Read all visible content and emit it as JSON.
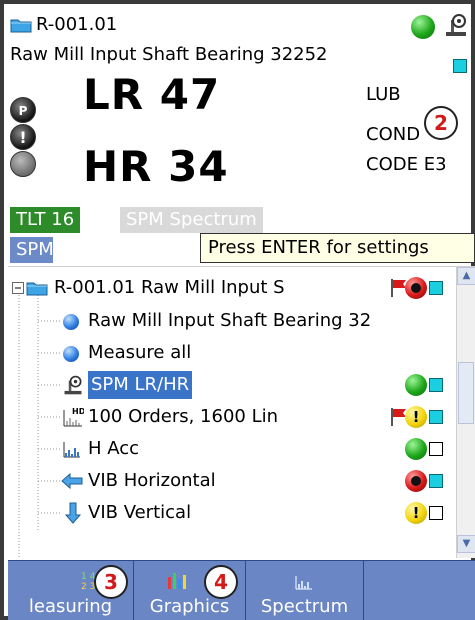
{
  "header": {
    "id": "R-001.01",
    "name": "Raw Mill Input Shaft Bearing 32252",
    "lr_label": "LR 47",
    "hr_label": "HR 34",
    "lub": "LUB",
    "cond": "COND",
    "code": "CODE  E3"
  },
  "tabs": {
    "tlt": "TLT 16",
    "spm_spectrum": "SPM Spectrum",
    "spm": "SPM"
  },
  "tooltip": "Press ENTER for settings",
  "tree": {
    "root": "R-001.01 Raw Mill Input S",
    "items": [
      "Raw Mill Input Shaft Bearing 32",
      "Measure all",
      "SPM LR/HR",
      "100 Orders, 1600 Lin",
      "H Acc",
      "VIB Horizontal",
      "VIB Vertical"
    ]
  },
  "toolbar": {
    "measuring": "leasuring",
    "graphics": "Graphics",
    "spectrum": "Spectrum"
  },
  "badges": {
    "b2": "2",
    "b3": "3",
    "b4": "4"
  },
  "colors": {
    "selection": "#3a74c8",
    "toolbar": "#6b86c4",
    "tab_green": "#2e8b2a",
    "badge_text": "#d21a1a"
  }
}
